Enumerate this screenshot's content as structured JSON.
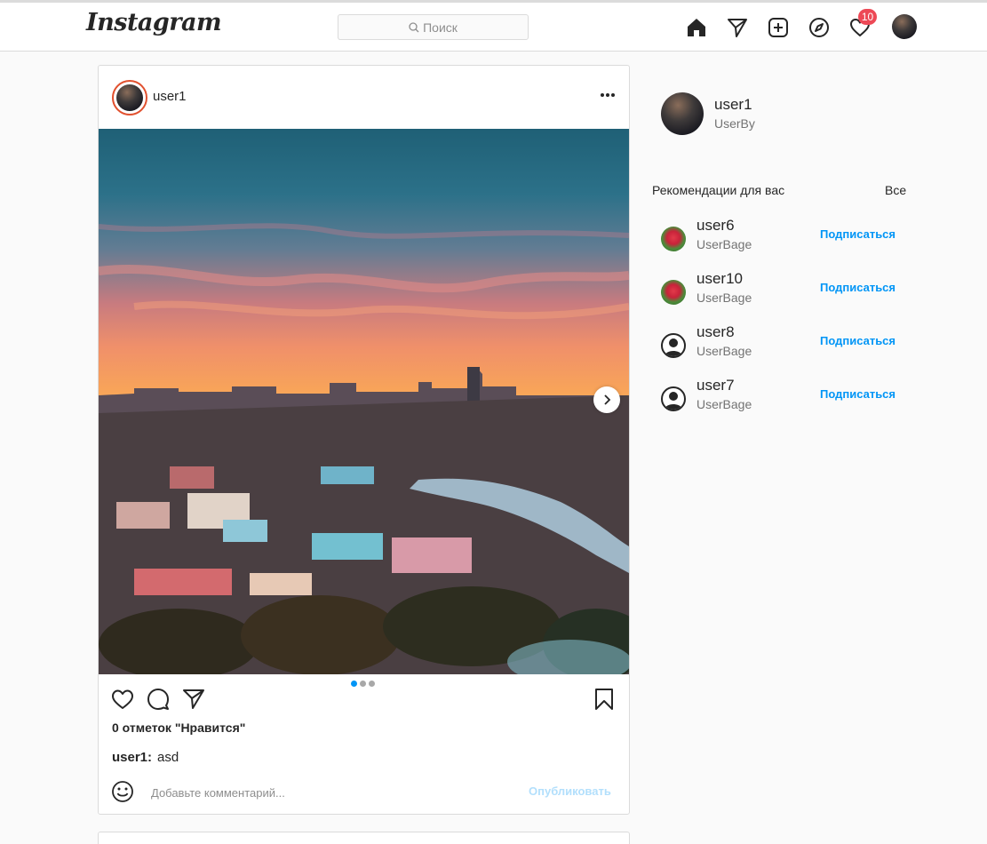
{
  "header": {
    "logo": "Instagram",
    "search_placeholder": "Поиск",
    "notification_count": "10",
    "nav_icons": [
      "home-icon",
      "direct-icon",
      "new-post-icon",
      "explore-icon",
      "activity-icon",
      "profile-avatar"
    ]
  },
  "post": {
    "username": "user1",
    "likes_text": "0 отметок  \"Нравится\"",
    "caption_user": "user1:",
    "caption_text": "asd",
    "comment_placeholder": "Добавьте комментарий...",
    "publish_label": "Опубликовать",
    "carousel": {
      "slides": 3,
      "active_index": 0
    },
    "icons": [
      "like-icon",
      "comment-icon",
      "share-icon",
      "save-icon",
      "more-icon",
      "emoji-icon",
      "next-slide-icon"
    ]
  },
  "sidebar": {
    "me": {
      "username": "user1",
      "fullname": "UserBy"
    },
    "recommendations_title": "Рекомендации для вас",
    "see_all": "Все",
    "users": [
      {
        "username": "user6",
        "fullname": "UserBage",
        "follow": "Подписаться",
        "avatar": "flower"
      },
      {
        "username": "user10",
        "fullname": "UserBage",
        "follow": "Подписаться",
        "avatar": "flower"
      },
      {
        "username": "user8",
        "fullname": "UserBage",
        "follow": "Подписаться",
        "avatar": "default"
      },
      {
        "username": "user7",
        "fullname": "UserBage",
        "follow": "Подписаться",
        "avatar": "default"
      }
    ]
  },
  "colors": {
    "accent": "#0095f6",
    "badge": "#ed4956",
    "story_ring": "#e1512f",
    "border": "#dbdbdb"
  }
}
